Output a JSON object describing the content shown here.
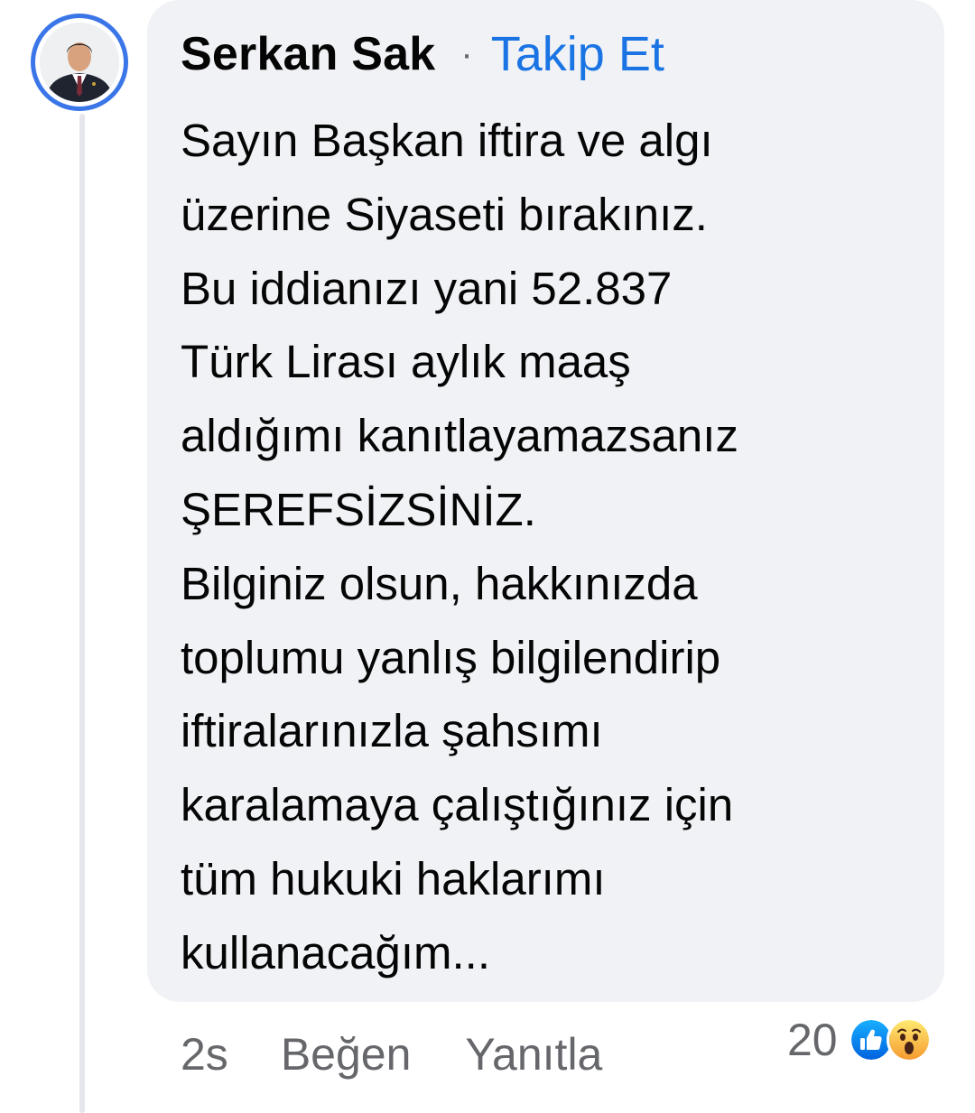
{
  "comment": {
    "author": "Serkan Sak",
    "separator": "·",
    "follow_label": "Takip Et",
    "text_lines": [
      "Sayın Başkan iftira ve algı",
      "üzerine Siyaseti bırakınız.",
      "Bu iddianızı yani 52.837",
      "Türk Lirası aylık maaş",
      "aldığımı kanıtlayamazsanız",
      "ŞEREFSİZSİNİZ.",
      "Bilginiz olsun, hakkınızda",
      "toplumu yanlış bilgilendirip",
      "iftiralarınızla şahsımı",
      "karalamaya çalıştığınız için",
      "tüm hukuki haklarımı",
      "kullanacağım..."
    ]
  },
  "actions": {
    "time": "2s",
    "like_label": "Beğen",
    "reply_label": "Yanıtla"
  },
  "reactions": {
    "count": "20",
    "icons": [
      "like-reaction-icon",
      "wow-reaction-icon"
    ]
  },
  "colors": {
    "bubble": "#f0f2f5",
    "link": "#1b74e4",
    "muted": "#65676b",
    "avatar_ring": "#3b76e8"
  }
}
